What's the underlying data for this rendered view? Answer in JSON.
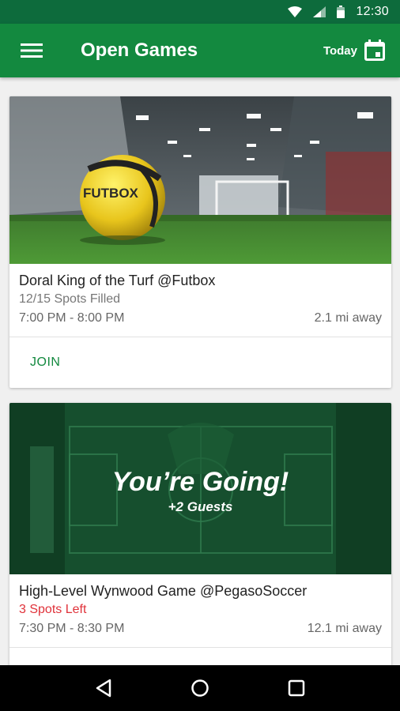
{
  "status_bar": {
    "time": "12:30"
  },
  "app_bar": {
    "title": "Open Games",
    "today_label": "Today"
  },
  "games": [
    {
      "title": "Doral King of the Turf @Futbox",
      "spots": "12/15 Spots Filled",
      "time": "7:00 PM - 8:00 PM",
      "distance": "2.1 mi away",
      "action_label": "JOIN",
      "ball_logo": "FUTBOX"
    },
    {
      "title": "High-Level Wynwood Game @PegasoSoccer",
      "spots": "3 Spots Left",
      "time": "7:30 PM - 8:30 PM",
      "distance": "12.1 mi away",
      "going_title": "You’re Going!",
      "going_sub": "+2 Guests"
    }
  ],
  "colors": {
    "primary": "#13893f",
    "status_bar": "#0d6b3c",
    "alert": "#e0323a"
  },
  "icons": [
    "wifi-icon",
    "signal-icon",
    "battery-icon",
    "menu-icon",
    "calendar-icon",
    "back-icon",
    "home-icon",
    "recents-icon"
  ]
}
